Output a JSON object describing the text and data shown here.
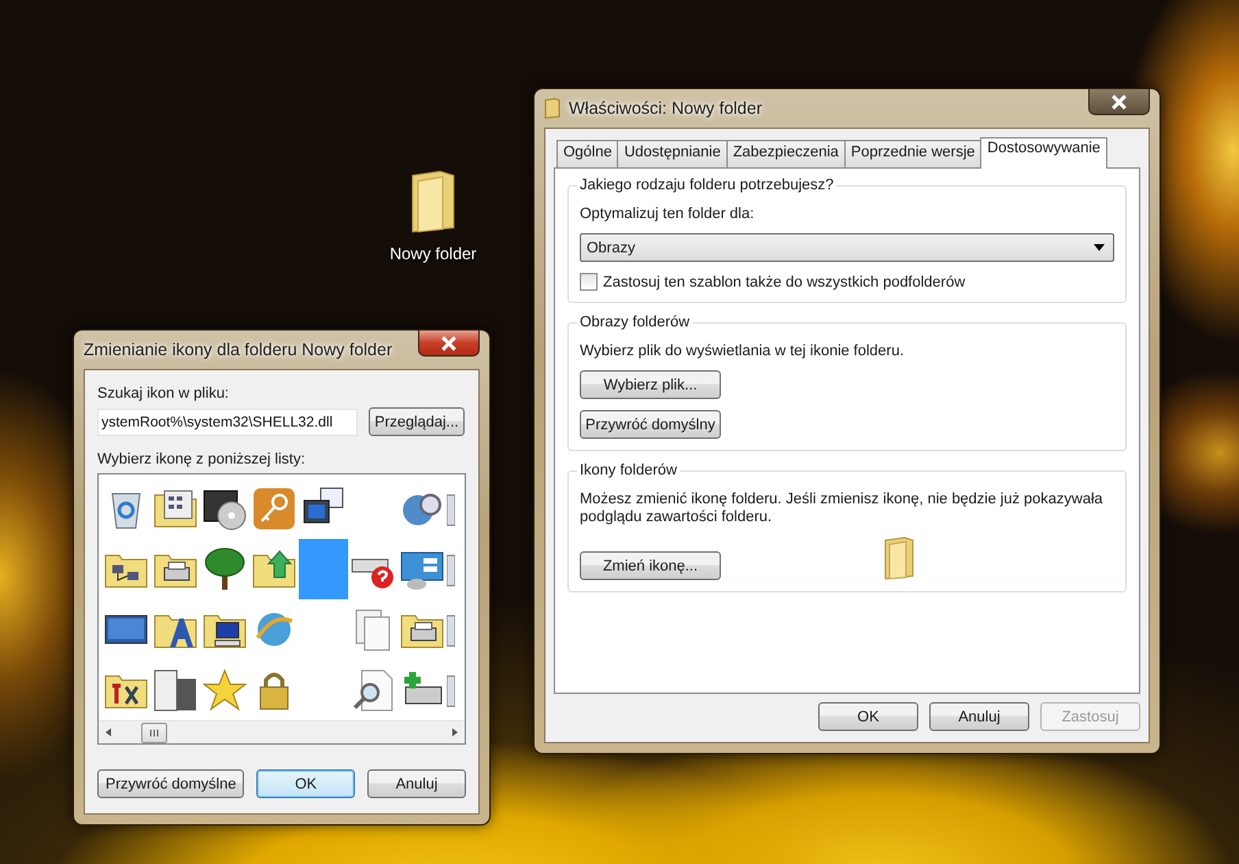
{
  "desktop": {
    "items": [
      {
        "label": "Nowy folder"
      }
    ]
  },
  "properties_window": {
    "title": "Właściwości: Nowy folder",
    "tabs": [
      {
        "label": "Ogólne",
        "selected": false
      },
      {
        "label": "Udostępnianie",
        "selected": false
      },
      {
        "label": "Zabezpieczenia",
        "selected": false
      },
      {
        "label": "Poprzednie wersje",
        "selected": false
      },
      {
        "label": "Dostosowywanie",
        "selected": true
      }
    ],
    "folder_type": {
      "heading": "Jakiego rodzaju folderu potrzebujesz?",
      "label": "Optymalizuj ten folder dla:",
      "dropdown": "Obrazy",
      "checkbox": {
        "label": "Zastosuj ten szablon także do wszystkich podfolderów",
        "checked": false
      }
    },
    "folder_pictures": {
      "heading": "Obrazy folderów",
      "text": "Wybierz plik do wyświetlania w tej ikonie folderu.",
      "buttons": [
        "Wybierz plik...",
        "Przywróć domyślny"
      ]
    },
    "folder_icons": {
      "heading": "Ikony folderów",
      "text": "Możesz zmienić ikonę folderu. Jeśli zmienisz ikonę, nie będzie już pokazywała podglądu zawartości folderu.",
      "button": "Zmień ikonę..."
    },
    "buttons": [
      {
        "label": "OK",
        "disabled": false
      },
      {
        "label": "Anuluj",
        "disabled": false
      },
      {
        "label": "Zastosuj",
        "disabled": true
      }
    ]
  },
  "change_icon_dialog": {
    "title": "Zmienianie ikony dla folderu Nowy folder",
    "file_label": "Szukaj ikon w pliku:",
    "file_value": "ystemRoot%\\system32\\SHELL32.dll",
    "browse_button": "Przeglądaj...",
    "list_label": "Wybierz ikonę z poniższej listy:",
    "icons": [
      {
        "kind": "recycle-bin",
        "selected": false
      },
      {
        "kind": "folder-grid",
        "selected": false
      },
      {
        "kind": "disc",
        "selected": false
      },
      {
        "kind": "key",
        "selected": false
      },
      {
        "kind": "computer",
        "selected": false
      },
      {
        "kind": "empty"
      },
      {
        "kind": "globe-search",
        "selected": false
      },
      {
        "kind": "partial",
        "selected": false
      },
      {
        "kind": "folder-network",
        "selected": false
      },
      {
        "kind": "folder-printer",
        "selected": false
      },
      {
        "kind": "tree",
        "selected": false
      },
      {
        "kind": "folder-arrow",
        "selected": false
      },
      {
        "kind": "empty",
        "selected": true
      },
      {
        "kind": "drive-help",
        "selected": false
      },
      {
        "kind": "control-panel",
        "selected": false
      },
      {
        "kind": "partial",
        "selected": false
      },
      {
        "kind": "monitor",
        "selected": false
      },
      {
        "kind": "folder-font",
        "selected": false
      },
      {
        "kind": "folder-computer",
        "selected": false
      },
      {
        "kind": "globe",
        "selected": false
      },
      {
        "kind": "empty"
      },
      {
        "kind": "documents",
        "selected": false
      },
      {
        "kind": "folder-printer",
        "selected": false
      },
      {
        "kind": "partial",
        "selected": false
      },
      {
        "kind": "folder-tools",
        "selected": false
      },
      {
        "kind": "server",
        "selected": false
      },
      {
        "kind": "star",
        "selected": false
      },
      {
        "kind": "lock",
        "selected": false
      },
      {
        "kind": "empty"
      },
      {
        "kind": "document-search",
        "selected": false
      },
      {
        "kind": "printer-add",
        "selected": false
      },
      {
        "kind": "partial",
        "selected": false
      }
    ],
    "buttons": [
      {
        "label": "Przywróć domyślne",
        "default": false
      },
      {
        "label": "OK",
        "default": true
      },
      {
        "label": "Anuluj",
        "default": false
      }
    ]
  }
}
